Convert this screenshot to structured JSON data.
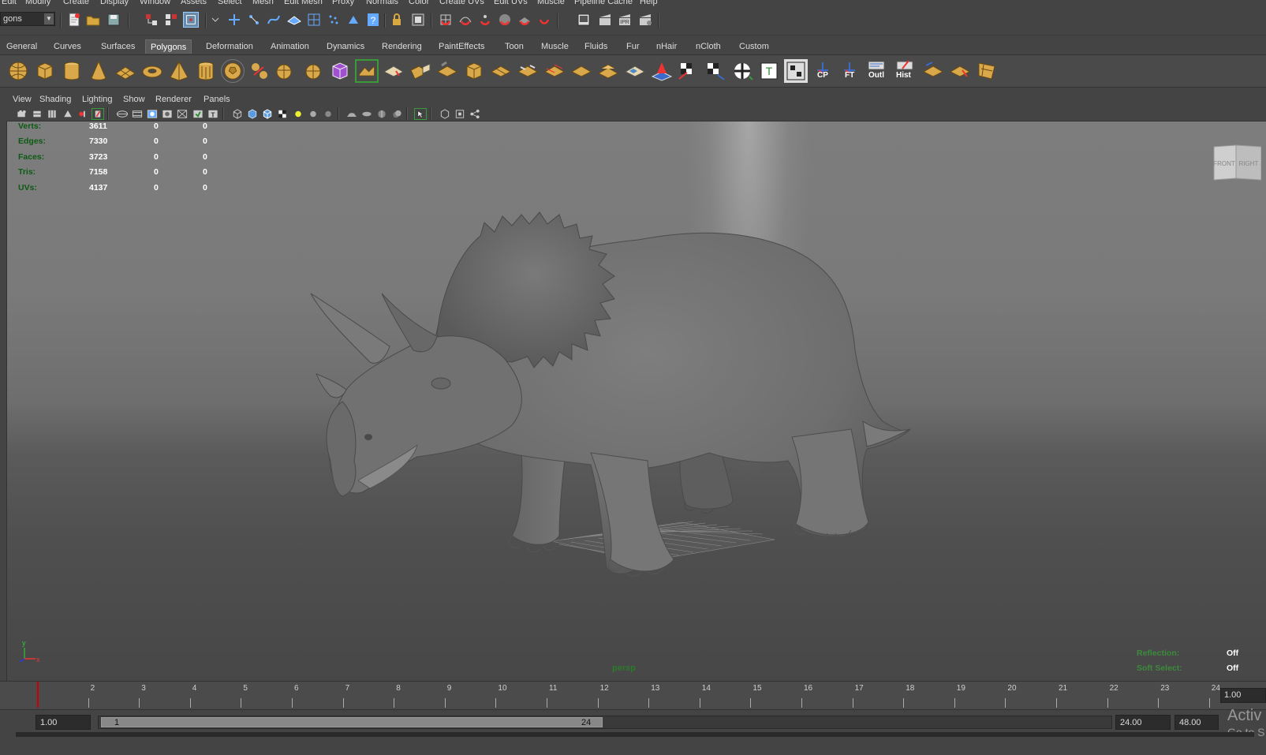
{
  "menubar": {
    "items": [
      "Edit",
      "Modify",
      "Create",
      "Display",
      "Window",
      "Assets",
      "Select",
      "Mesh",
      "Edit Mesh",
      "Proxy",
      "Normals",
      "Color",
      "Create UVs",
      "Edit UVs",
      "Muscle",
      "Pipeline Cache",
      "Help"
    ]
  },
  "statusline": {
    "mode_value": "gons"
  },
  "shelf": {
    "tabs": [
      "General",
      "Curves",
      "Surfaces",
      "Polygons",
      "Deformation",
      "Animation",
      "Dynamics",
      "Rendering",
      "PaintEffects",
      "Toon",
      "Muscle",
      "Fluids",
      "Fur",
      "nHair",
      "nCloth",
      "Custom"
    ],
    "active_tab": "Polygons",
    "labels": {
      "cp": "CP",
      "ft": "FT",
      "outl": "Outl",
      "hist": "Hist"
    }
  },
  "panel": {
    "menus": [
      "View",
      "Shading",
      "Lighting",
      "Show",
      "Renderer",
      "Panels"
    ]
  },
  "hud": {
    "rows": [
      {
        "label": "Verts:",
        "v1": "3611",
        "v2": "0",
        "v3": "0"
      },
      {
        "label": "Edges:",
        "v1": "7330",
        "v2": "0",
        "v3": "0"
      },
      {
        "label": "Faces:",
        "v1": "3723",
        "v2": "0",
        "v3": "0"
      },
      {
        "label": "Tris:",
        "v1": "7158",
        "v2": "0",
        "v3": "0"
      },
      {
        "label": "UVs:",
        "v1": "4137",
        "v2": "0",
        "v3": "0"
      }
    ],
    "camera": "persp",
    "reflection_label": "Reflection:",
    "reflection_value": "Off",
    "soft_select_label": "Soft Select:",
    "soft_select_value": "Off",
    "viewcube_front": "FRONT",
    "viewcube_right": "RIGHT",
    "axis_y": "y",
    "axis_x": "x"
  },
  "timeline": {
    "ticks": [
      "2",
      "3",
      "4",
      "5",
      "6",
      "7",
      "8",
      "9",
      "10",
      "11",
      "12",
      "13",
      "14",
      "15",
      "16",
      "17",
      "18",
      "19",
      "20",
      "21",
      "22",
      "23",
      "24"
    ],
    "current_frame": "1.00"
  },
  "range": {
    "start": "1.00",
    "inner_start": "1",
    "inner_end": "24",
    "end": "24.00",
    "anim_end": "48.00"
  },
  "watermark": {
    "line1": "Activ",
    "line2": "Go to S"
  }
}
